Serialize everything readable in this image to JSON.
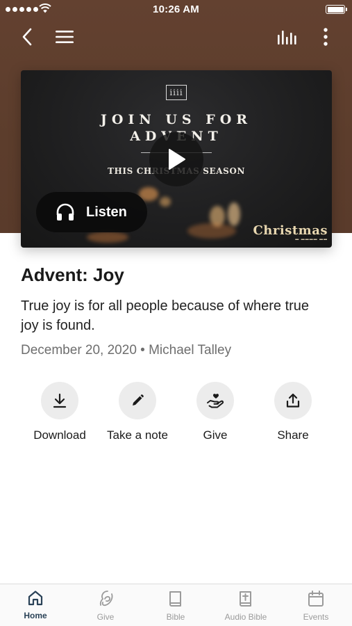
{
  "status_bar": {
    "time": "10:26 AM"
  },
  "video": {
    "logo_text": "iiii",
    "line1": "JOIN US FOR",
    "line2": "ADVENT",
    "line3": "THIS CHRISTMAS SEASON",
    "brand": "Christmas",
    "listen_label": "Listen"
  },
  "content": {
    "title": "Advent: Joy",
    "summary": "True joy is for all people because of where true joy is found.",
    "date": "December 20, 2020",
    "speaker": "Michael Talley",
    "separator": "•"
  },
  "actions": [
    {
      "label": "Download",
      "icon": "download-icon"
    },
    {
      "label": "Take a note",
      "icon": "pencil-icon"
    },
    {
      "label": "Give",
      "icon": "give-hand-heart-icon"
    },
    {
      "label": "Share",
      "icon": "share-icon"
    }
  ],
  "tabs": [
    {
      "label": "Home",
      "icon": "home-icon",
      "active": true
    },
    {
      "label": "Give",
      "icon": "give-icon",
      "active": false
    },
    {
      "label": "Bible",
      "icon": "book-icon",
      "active": false
    },
    {
      "label": "Audio Bible",
      "icon": "audio-bible-icon",
      "active": false
    },
    {
      "label": "Events",
      "icon": "calendar-icon",
      "active": false
    }
  ],
  "colors": {
    "header_brown": "#5c3d2c",
    "active_tab": "#2a4257",
    "inactive_tab": "#9a9a9a",
    "action_circle": "#ececec"
  }
}
